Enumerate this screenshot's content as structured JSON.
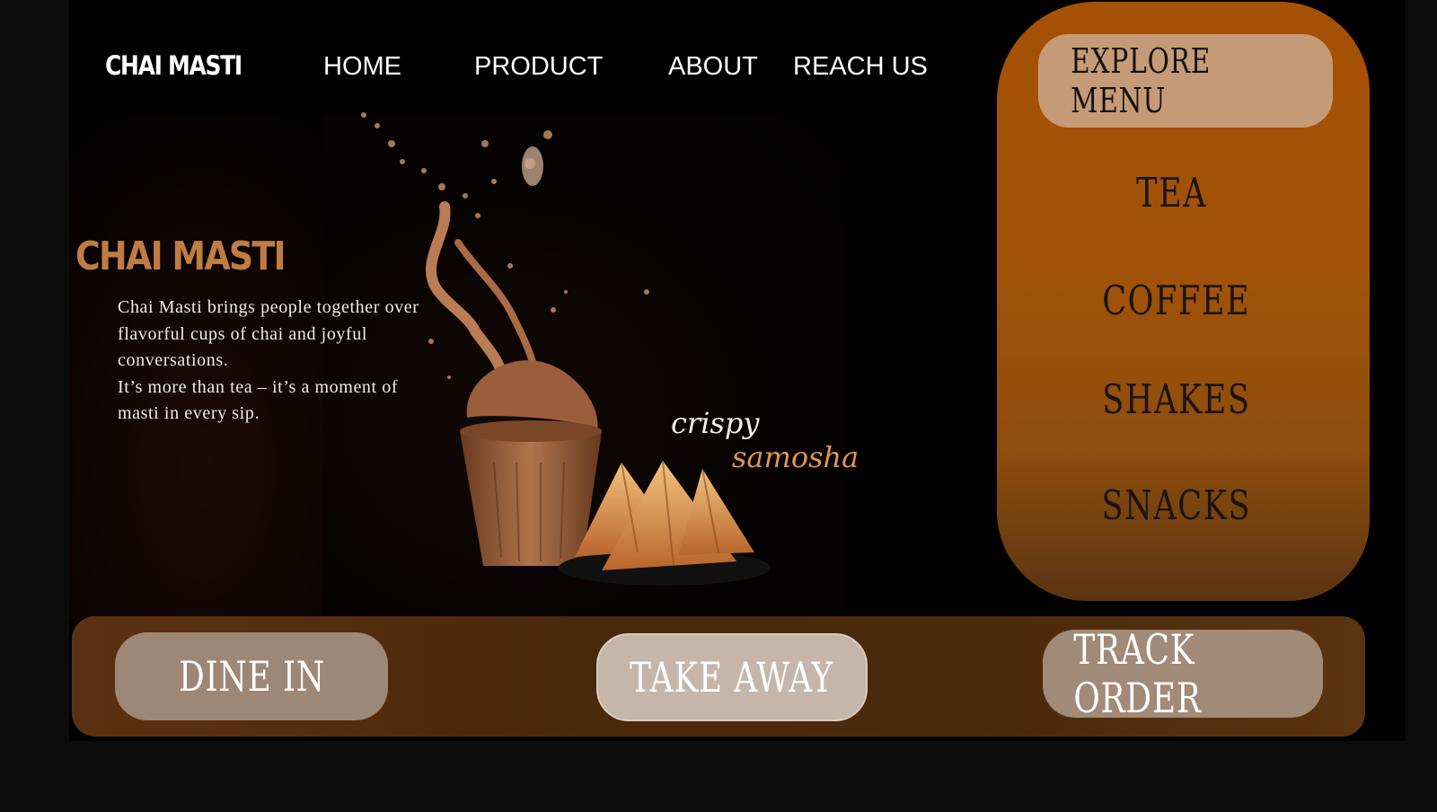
{
  "brand": {
    "logo_text": "CHAI MASTI"
  },
  "nav": {
    "home": "HOME",
    "product": "PRODUCT",
    "about": "ABOUT",
    "reach_us": "REACH US"
  },
  "hero": {
    "title": "CHAI MASTI",
    "desc_p1": "Chai Masti brings people together over flavorful cups of chai and joyful conversations.",
    "desc_p2": "It’s more than tea – it’s a moment of masti in every sip.",
    "tag_crispy": "crispy",
    "tag_samosha": "samosha"
  },
  "menu": {
    "explore_label": "EXPLORE MENU",
    "items": [
      "TEA",
      "COFFEE",
      "SHAKES",
      "SNACKS"
    ]
  },
  "actions": {
    "dine_in": "DINE IN",
    "take_away": "TAKE AWAY",
    "track_order": "TRACK ORDER"
  },
  "colors": {
    "accent_orange": "#a55105",
    "title_tan": "#c07c43",
    "samosha_orange": "#e2954c",
    "bar_brown": "#4a280b"
  }
}
